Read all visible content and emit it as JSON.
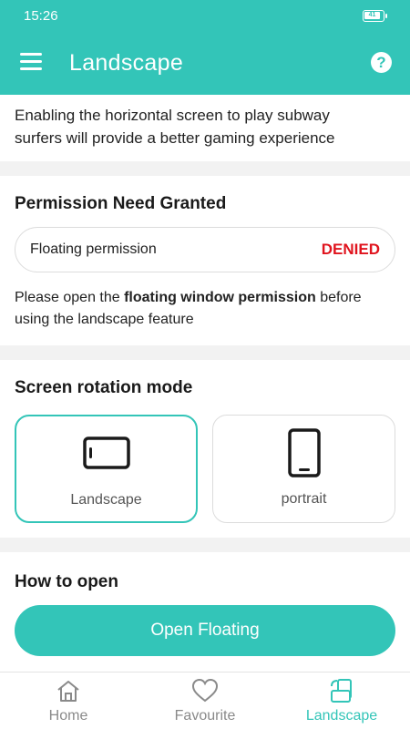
{
  "status": {
    "time": "15:26",
    "battery": "41"
  },
  "appbar": {
    "title": "Landscape",
    "menu_icon": "menu-icon",
    "help_icon": "help-icon"
  },
  "intro": {
    "text": "Enabling the horizontal screen to play subway surfers will provide a better gaming experience"
  },
  "permission": {
    "title": "Permission Need Granted",
    "item_label": "Floating permission",
    "item_status": "DENIED",
    "note_prefix": "Please open the ",
    "note_bold": "floating window permission",
    "note_suffix": " before using the landscape feature"
  },
  "rotation": {
    "title": "Screen rotation mode",
    "modes": [
      {
        "label": "Landscape",
        "icon": "tablet-landscape-icon",
        "selected": true
      },
      {
        "label": "portrait",
        "icon": "phone-portrait-icon",
        "selected": false
      }
    ]
  },
  "howto": {
    "title": "How to open",
    "button_label": "Open Floating"
  },
  "nav": {
    "items": [
      {
        "label": "Home",
        "icon": "home-icon",
        "active": false
      },
      {
        "label": "Favourite",
        "icon": "heart-icon",
        "active": false
      },
      {
        "label": "Landscape",
        "icon": "rotate-screen-icon",
        "active": true
      }
    ]
  },
  "colors": {
    "accent": "#33c5b8",
    "danger": "#e0141e"
  }
}
